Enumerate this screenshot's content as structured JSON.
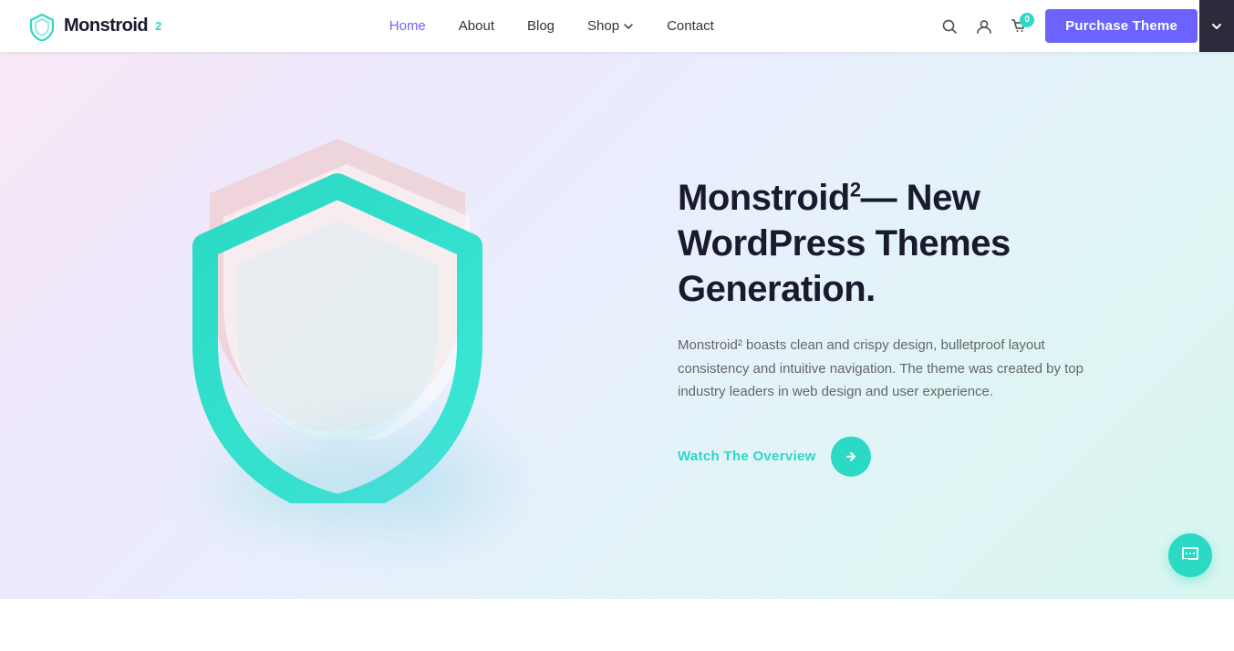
{
  "navbar": {
    "logo_text": "Monstroid",
    "logo_sup": "2",
    "nav_items": [
      {
        "label": "Home",
        "active": true
      },
      {
        "label": "About",
        "active": false
      },
      {
        "label": "Blog",
        "active": false
      },
      {
        "label": "Shop",
        "active": false,
        "has_dropdown": true
      },
      {
        "label": "Contact",
        "active": false
      }
    ],
    "cart_count": "0",
    "purchase_btn": "Purchase Theme"
  },
  "hero": {
    "title_text": "Monstroid",
    "title_sup": "2",
    "title_dash": "— New WordPress Themes Generation.",
    "description": "Monstroid² boasts clean and crispy design, bulletproof layout consistency and intuitive navigation. The theme was created by top industry leaders in web design and user experience.",
    "cta_link": "Watch The Overview",
    "cta_arrow": "›"
  },
  "icons": {
    "search": "🔍",
    "user": "👤",
    "cart": "🛍",
    "chevron_down": "▾",
    "chevron_right": ">",
    "chat": "💬",
    "side_panel": "▼"
  },
  "colors": {
    "accent": "#6c63ff",
    "teal": "#2bd9c4",
    "dark": "#1a1a2e"
  }
}
